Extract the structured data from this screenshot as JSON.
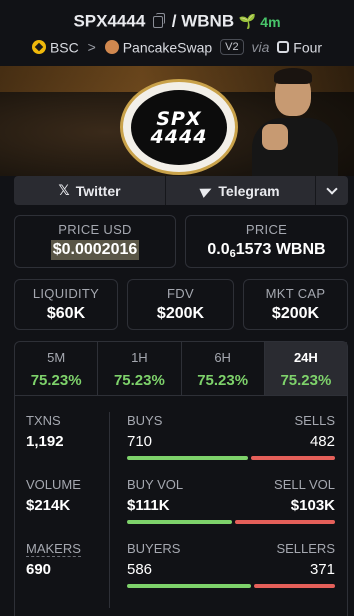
{
  "header": {
    "symbol": "SPX4444",
    "separator": "/",
    "quote": "WBNB",
    "age": "4m",
    "chain": "BSC",
    "breadcrumb_sep": ">",
    "dex": "PancakeSwap",
    "version": "V2",
    "via": "via",
    "launchpad": "Four"
  },
  "banner": {
    "logo_line1": "SPX",
    "logo_line2": "4444"
  },
  "social": {
    "twitter": "Twitter",
    "telegram": "Telegram"
  },
  "price": {
    "usd_label": "PRICE USD",
    "usd_value": "$0.0002016",
    "native_label": "PRICE",
    "native_prefix": "0.0",
    "native_zeros": "6",
    "native_digits": "1573 WBNB"
  },
  "metrics": {
    "liquidity_label": "LIQUIDITY",
    "liquidity_value": "$60K",
    "fdv_label": "FDV",
    "fdv_value": "$200K",
    "mcap_label": "MKT CAP",
    "mcap_value": "$200K"
  },
  "tabs": [
    {
      "label": "5M",
      "value": "75.23%"
    },
    {
      "label": "1H",
      "value": "75.23%"
    },
    {
      "label": "6H",
      "value": "75.23%"
    },
    {
      "label": "24H",
      "value": "75.23%"
    }
  ],
  "stats": {
    "txns_label": "TXNS",
    "txns_value": "1,192",
    "buys_label": "BUYS",
    "buys_value": "710",
    "sells_label": "SELLS",
    "sells_value": "482",
    "volume_label": "VOLUME",
    "volume_value": "$214K",
    "buyvol_label": "BUY VOL",
    "buyvol_value": "$111K",
    "sellvol_label": "SELL VOL",
    "sellvol_value": "$103K",
    "makers_label": "MAKERS",
    "makers_value": "690",
    "buyers_label": "BUYERS",
    "buyers_value": "586",
    "sellers_label": "SELLERS",
    "sellers_value": "371"
  },
  "bars": {
    "buys_fraction": 0.596,
    "buyvol_fraction": 0.519,
    "buyers_fraction": 0.612
  },
  "colors": {
    "positive": "#7ed26b",
    "negative": "#e5605a",
    "background": "#111216"
  }
}
